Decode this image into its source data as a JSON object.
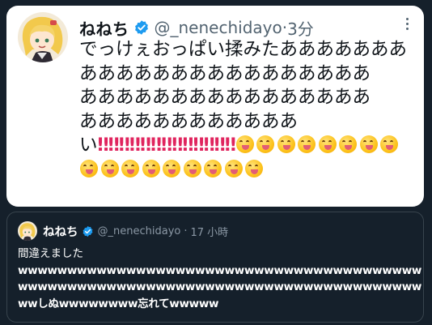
{
  "main_tweet": {
    "author_name": "ねねち",
    "handle": "@_nenechidayo",
    "separator": "·",
    "time": "3分",
    "text_lines": [
      "でっけぇおっぱい揉みたあああああああ",
      "ああああああああああああああああ",
      "ああああああああああああああああ",
      "ああああああああああああ"
    ],
    "last_line_prefix": "い",
    "bangs": "‼‼‼‼‼‼‼‼‼‼‼‼‼",
    "emoji_name": "face-savoring-food-emoji",
    "emoji_count": 17
  },
  "quoted_tweet": {
    "author_name": "ねねち",
    "handle": "@_nenechidayo",
    "separator": "·",
    "time": "17 小時",
    "line1": "間違えました",
    "line2": "wwwwwwwwwwwwwwwwwwwwwwwwwwwwwwwwwwwwwwwww",
    "line3": "wwwwwwwwwwwwwwwwwwwwwwwwwwwwwwwwwwwwwwwww",
    "line4": "wwしぬwwwwwwww忘れてwwwww"
  },
  "colors": {
    "background": "#15202b",
    "card_white": "#ffffff",
    "verified_blue": "#1d9bf0",
    "bang_red": "#e0245e"
  }
}
